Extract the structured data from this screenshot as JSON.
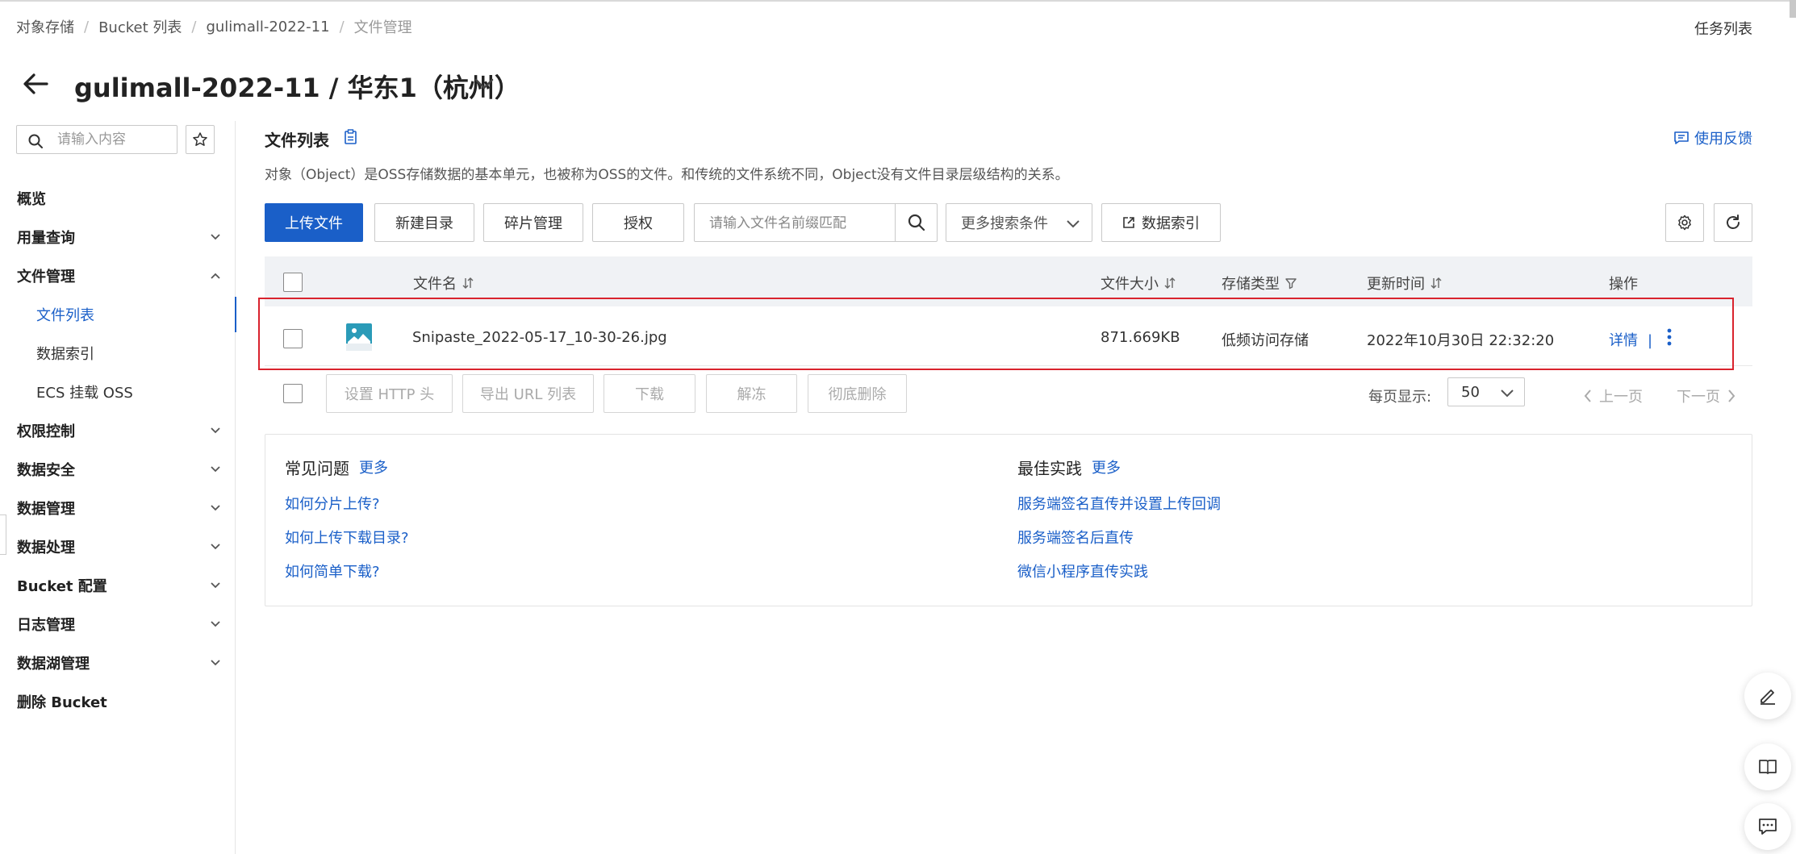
{
  "breadcrumb": [
    "对象存储",
    "Bucket 列表",
    "gulimall-2022-11",
    "文件管理"
  ],
  "task_list": "任务列表",
  "page_title": "gulimall-2022-11 / 华东1（杭州）",
  "sidebar": {
    "search_placeholder": "请输入内容",
    "items": [
      {
        "label": "概览",
        "chevron": "none"
      },
      {
        "label": "用量查询",
        "chevron": "down"
      },
      {
        "label": "文件管理",
        "chevron": "up"
      },
      {
        "label": "文件列表",
        "sub": true,
        "active": true
      },
      {
        "label": "数据索引",
        "sub": true
      },
      {
        "label": "ECS 挂载 OSS",
        "sub": true
      },
      {
        "label": "权限控制",
        "chevron": "down"
      },
      {
        "label": "数据安全",
        "chevron": "down"
      },
      {
        "label": "数据管理",
        "chevron": "down"
      },
      {
        "label": "数据处理",
        "chevron": "down"
      },
      {
        "label": "Bucket 配置",
        "chevron": "down"
      },
      {
        "label": "日志管理",
        "chevron": "down"
      },
      {
        "label": "数据湖管理",
        "chevron": "down"
      },
      {
        "label": "删除 Bucket",
        "chevron": "none"
      }
    ]
  },
  "main": {
    "section_title": "文件列表",
    "feedback": "使用反馈",
    "description": "对象（Object）是OSS存储数据的基本单元，也被称为OSS的文件。和传统的文件系统不同，Object没有文件目录层级结构的关系。",
    "toolbar": {
      "upload": "上传文件",
      "new_dir": "新建目录",
      "fragments": "碎片管理",
      "authorize": "授权",
      "search_placeholder": "请输入文件名前缀匹配",
      "more_conditions": "更多搜索条件",
      "data_index": "数据索引"
    },
    "table": {
      "columns": {
        "name": "文件名",
        "size": "文件大小",
        "storage": "存储类型",
        "updated": "更新时间",
        "ops": "操作"
      },
      "rows": [
        {
          "name": "Snipaste_2022-05-17_10-30-26.jpg",
          "size": "871.669KB",
          "storage": "低频访问存储",
          "updated": "2022年10月30日 22:32:20",
          "detail": "详情",
          "sep": "|"
        }
      ]
    },
    "bulk": {
      "set_http": "设置 HTTP 头",
      "export_url": "导出 URL 列表",
      "download": "下载",
      "unfreeze": "解冻",
      "delete": "彻底删除",
      "page_size_label": "每页显示:",
      "page_size": "50",
      "prev": "上一页",
      "next": "下一页"
    },
    "faq": {
      "title": "常见问题",
      "more": "更多",
      "links": [
        "如何分片上传?",
        "如何上传下载目录?",
        "如何简单下载?"
      ]
    },
    "best": {
      "title": "最佳实践",
      "more": "更多",
      "links": [
        "服务端签名直传并设置上传回调",
        "服务端签名后直传",
        "微信小程序直传实践"
      ]
    }
  },
  "colors": {
    "accent": "#1a5fc8",
    "highlight": "#d9232d"
  },
  "icons": [
    "back-arrow-icon",
    "chevron-down-icon",
    "search-icon",
    "star-icon",
    "clipboard-icon",
    "feedback-icon",
    "external-link-icon",
    "settings-icon",
    "refresh-icon",
    "sort-icon",
    "filter-icon",
    "image-file-icon",
    "more-vertical-icon",
    "edit-icon",
    "book-icon",
    "chat-icon"
  ]
}
